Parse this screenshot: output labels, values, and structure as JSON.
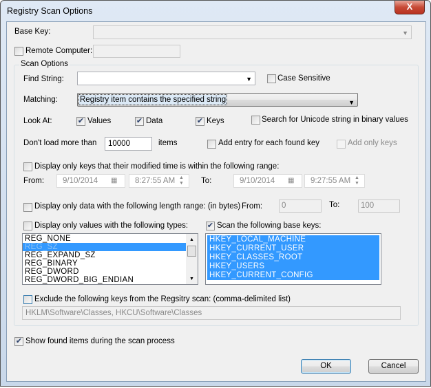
{
  "window": {
    "title": "Registry Scan Options",
    "close_label": "X"
  },
  "base_key": {
    "label": "Base Key:",
    "value": ""
  },
  "remote": {
    "label": "Remote Computer:",
    "checked": false,
    "value": ""
  },
  "scan_options": {
    "group_label": "Scan Options",
    "find_string": {
      "label": "Find String:",
      "value": ""
    },
    "case_sensitive": {
      "label": "Case Sensitive",
      "checked": false
    },
    "matching": {
      "label": "Matching:",
      "value": "Registry item contains the specified string"
    },
    "look_at": {
      "label": "Look At:",
      "values": "Values",
      "data": "Data",
      "keys": "Keys"
    },
    "unicode": {
      "label": "Search for Unicode string in binary values",
      "checked": false
    },
    "max": {
      "label": "Don't load more than",
      "value": "10000",
      "suffix": "items"
    },
    "add_entry": {
      "label": "Add entry for each found key",
      "checked": false
    },
    "add_only_keys": {
      "label": "Add only keys",
      "checked": false
    },
    "time_range": {
      "label": "Display only keys that their modified time is within the following range:",
      "from_label": "From:",
      "from_date": "9/10/2014",
      "from_time": "8:27:55 AM",
      "to_label": "To:",
      "to_date": "9/10/2014",
      "to_time": "9:27:55 AM"
    },
    "length_range": {
      "label": "Display only data with the following length range: (in bytes)",
      "from_label": "From:",
      "from_value": "0",
      "to_label": "To:",
      "to_value": "100"
    },
    "types": {
      "label": "Display only values with the following types:",
      "items": [
        "REG_NONE",
        "REG_SZ",
        "REG_EXPAND_SZ",
        "REG_BINARY",
        "REG_DWORD",
        "REG_DWORD_BIG_ENDIAN"
      ]
    },
    "base_keys": {
      "label": "Scan the following base keys:",
      "checked": true,
      "items": [
        "HKEY_LOCAL_MACHINE",
        "HKEY_CURRENT_USER",
        "HKEY_CLASSES_ROOT",
        "HKEY_USERS",
        "HKEY_CURRENT_CONFIG"
      ]
    },
    "exclude": {
      "label": "Exclude the following keys from the Regsitry scan: (comma-delimited list)",
      "value": "HKLM\\Software\\Classes, HKCU\\Software\\Classes"
    }
  },
  "show_found": {
    "label": "Show found items during the scan process",
    "checked": true
  },
  "buttons": {
    "ok": "OK",
    "cancel": "Cancel"
  },
  "check_mark": "✔",
  "icons": {
    "dropdown": "▼",
    "spin_up": "▲",
    "spin_down": "▼",
    "calendar": "▦"
  }
}
